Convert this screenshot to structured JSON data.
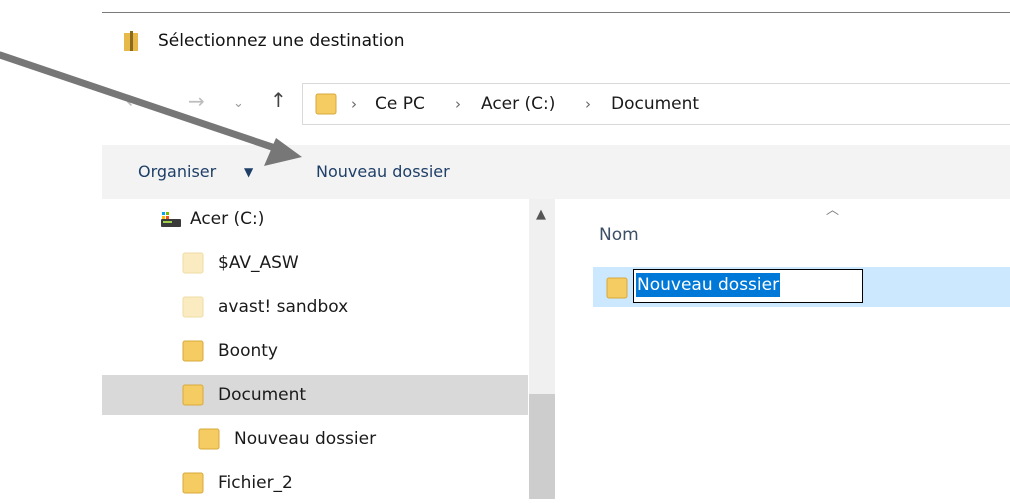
{
  "window": {
    "title": "Sélectionnez une destination"
  },
  "nav": {
    "back_icon": "arrow-left-icon",
    "forward_icon": "arrow-right-icon",
    "recent_icon": "chevron-down-icon",
    "up_icon": "arrow-up-icon"
  },
  "breadcrumb": [
    {
      "label": "Ce PC"
    },
    {
      "label": "Acer (C:)"
    },
    {
      "label": "Document"
    }
  ],
  "toolbar": {
    "organise_label": "Organiser",
    "new_folder_label": "Nouveau dossier"
  },
  "tree": [
    {
      "label": "Acer (C:)",
      "icon": "drive-icon"
    },
    {
      "label": "$AV_ASW",
      "icon": "folder-icon"
    },
    {
      "label": "avast! sandbox",
      "icon": "folder-icon"
    },
    {
      "label": "Boonty",
      "icon": "folder-icon"
    },
    {
      "label": "Document",
      "icon": "folder-icon",
      "selected": true
    },
    {
      "label": "Nouveau dossier",
      "icon": "folder-icon"
    },
    {
      "label": "Fichier_2",
      "icon": "folder-icon"
    }
  ],
  "content": {
    "column_name": "Nom",
    "rename_value": "Nouveau dossier"
  },
  "colors": {
    "folder": "#f4cc62",
    "folder_faded": "#fbebc0",
    "selection": "#0078d7",
    "row_highlight": "#cce8ff",
    "toolbar_bg": "#f3f3f3",
    "tree_selected": "#d9d9d9",
    "annotation_arrow": "#777777"
  }
}
